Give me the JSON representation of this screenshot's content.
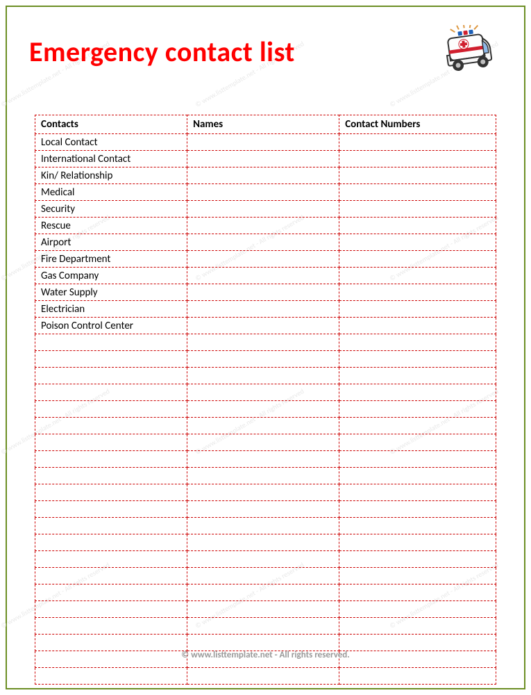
{
  "title": "Emergency contact list",
  "columns": [
    "Contacts",
    "Names",
    "Contact Numbers"
  ],
  "rows": [
    {
      "contact": "Local Contact",
      "name": "",
      "number": ""
    },
    {
      "contact": "International Contact",
      "name": "",
      "number": ""
    },
    {
      "contact": "Kin/ Relationship",
      "name": "",
      "number": ""
    },
    {
      "contact": "Medical",
      "name": "",
      "number": ""
    },
    {
      "contact": "Security",
      "name": "",
      "number": ""
    },
    {
      "contact": "Rescue",
      "name": "",
      "number": ""
    },
    {
      "contact": "Airport",
      "name": "",
      "number": ""
    },
    {
      "contact": "Fire Department",
      "name": "",
      "number": ""
    },
    {
      "contact": "Gas Company",
      "name": "",
      "number": ""
    },
    {
      "contact": "Water Supply",
      "name": "",
      "number": ""
    },
    {
      "contact": "Electrician",
      "name": "",
      "number": ""
    },
    {
      "contact": "Poison Control Center",
      "name": "",
      "number": ""
    }
  ],
  "empty_row_count": 21,
  "footer": "© www.listtemplate.net - All rights reserved.",
  "watermark": "© www.listtemplate.net - All rights reserved"
}
